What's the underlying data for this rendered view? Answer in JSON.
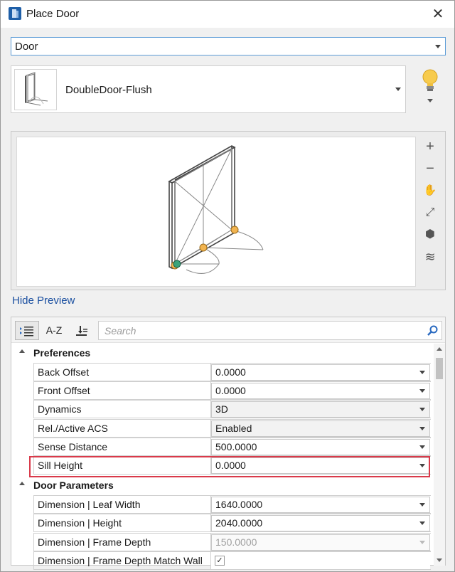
{
  "window": {
    "title": "Place Door",
    "close_glyph": "✕"
  },
  "type_select": {
    "value": "Door"
  },
  "template": {
    "name": "DoubleDoor-Flush"
  },
  "preview": {
    "toggle_label": "Hide Preview",
    "tools": [
      {
        "icon": "zoom-in-icon",
        "glyph": "+"
      },
      {
        "icon": "zoom-out-icon",
        "glyph": "−"
      },
      {
        "icon": "pan-hand-icon",
        "glyph": "✋"
      },
      {
        "icon": "fit-view-icon",
        "glyph": "⤢"
      },
      {
        "icon": "view-rotate-icon",
        "glyph": "⬢"
      },
      {
        "icon": "display-style-icon",
        "glyph": "≋"
      }
    ]
  },
  "properties": {
    "toolbar": {
      "az_label": "A-Z",
      "search_placeholder": "Search"
    },
    "sections": [
      {
        "title": "Preferences",
        "rows": [
          {
            "name": "Back Offset",
            "value": "0.0000",
            "style": "normal"
          },
          {
            "name": "Front Offset",
            "value": "0.0000",
            "style": "normal"
          },
          {
            "name": "Dynamics",
            "value": "3D",
            "style": "gray"
          },
          {
            "name": "Rel./Active ACS",
            "value": "Enabled",
            "style": "gray"
          },
          {
            "name": "Sense Distance",
            "value": "500.0000",
            "style": "normal"
          },
          {
            "name": "Sill Height",
            "value": "0.0000",
            "style": "normal"
          }
        ]
      },
      {
        "title": "Door Parameters",
        "rows": [
          {
            "name": "Dimension | Leaf Width",
            "value": "1640.0000",
            "style": "normal"
          },
          {
            "name": "Dimension | Height",
            "value": "2040.0000",
            "style": "normal"
          },
          {
            "name": "Dimension | Frame Depth",
            "value": "150.0000",
            "style": "disabled"
          },
          {
            "name": "Dimension | Frame Depth Match Wall",
            "value": "",
            "style": "checkbox",
            "checked": true
          }
        ]
      }
    ]
  }
}
